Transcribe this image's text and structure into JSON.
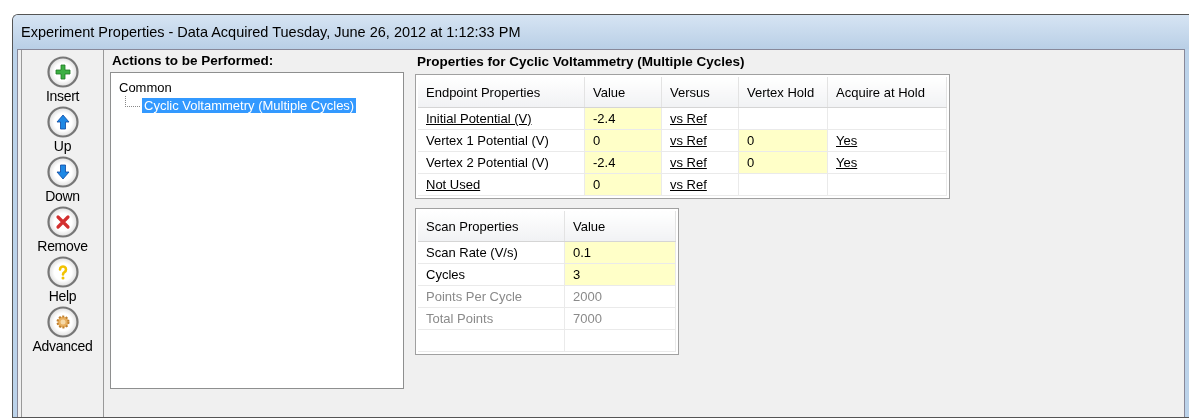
{
  "window": {
    "title": "Experiment Properties - Data Acquired Tuesday, June 26, 2012 at 1:12:33 PM"
  },
  "toolbar": [
    {
      "label": "Insert",
      "kind": "insert"
    },
    {
      "label": "Up",
      "kind": "up"
    },
    {
      "label": "Down",
      "kind": "down"
    },
    {
      "label": "Remove",
      "kind": "remove"
    },
    {
      "label": "Help",
      "kind": "help"
    },
    {
      "label": "Advanced",
      "kind": "advanced"
    }
  ],
  "actions": {
    "heading": "Actions to be Performed:",
    "tree": [
      {
        "label": "Common",
        "selected": false,
        "children": [
          {
            "label": "Cyclic Voltammetry (Multiple Cycles)",
            "selected": true
          }
        ]
      }
    ]
  },
  "properties": {
    "heading": "Properties for Cyclic Voltammetry (Multiple Cycles)",
    "endpoint_table": {
      "columns": [
        "Endpoint Properties",
        "Value",
        "Versus",
        "Vertex Hold",
        "Acquire at Hold"
      ],
      "rows": [
        [
          {
            "text": "Initial Potential (V)",
            "kind": "link"
          },
          {
            "text": "-2.4",
            "kind": "input"
          },
          {
            "text": "vs Ref",
            "kind": "link"
          },
          {
            "kind": "blank"
          },
          {
            "kind": "blank"
          }
        ],
        [
          {
            "text": "Vertex 1 Potential (V)",
            "kind": "plain"
          },
          {
            "text": "0",
            "kind": "input"
          },
          {
            "text": "vs Ref",
            "kind": "link"
          },
          {
            "text": "0",
            "kind": "input"
          },
          {
            "text": "Yes",
            "kind": "link"
          }
        ],
        [
          {
            "text": "Vertex 2 Potential (V)",
            "kind": "plain"
          },
          {
            "text": "-2.4",
            "kind": "input"
          },
          {
            "text": "vs Ref",
            "kind": "link"
          },
          {
            "text": "0",
            "kind": "input"
          },
          {
            "text": "Yes",
            "kind": "link"
          }
        ],
        [
          {
            "text": "Not Used",
            "kind": "link"
          },
          {
            "text": "0",
            "kind": "input"
          },
          {
            "text": "vs Ref",
            "kind": "link"
          },
          {
            "kind": "blank"
          },
          {
            "kind": "blank"
          }
        ]
      ]
    },
    "scan_table": {
      "columns": [
        "Scan Properties",
        "Value"
      ],
      "rows": [
        [
          {
            "text": "Scan Rate (V/s)",
            "kind": "plain"
          },
          {
            "text": "0.1",
            "kind": "input"
          }
        ],
        [
          {
            "text": "Cycles",
            "kind": "plain"
          },
          {
            "text": "3",
            "kind": "input"
          }
        ],
        [
          {
            "text": "Points Per Cycle",
            "kind": "muted"
          },
          {
            "text": "2000",
            "kind": "muted"
          }
        ],
        [
          {
            "text": "Total Points",
            "kind": "muted"
          },
          {
            "text": "7000",
            "kind": "muted"
          }
        ],
        [
          {
            "kind": "blank"
          },
          {
            "kind": "blank"
          }
        ]
      ]
    }
  }
}
